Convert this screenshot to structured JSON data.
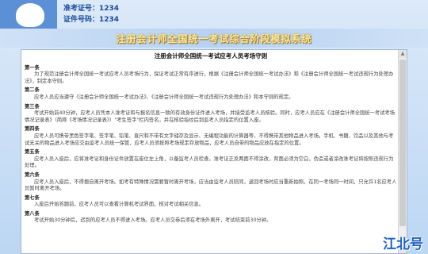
{
  "candidate": {
    "exam_no_label": "准考证号：",
    "exam_no": "1234",
    "id_no_label": "证件号码：",
    "id_no": "1234"
  },
  "banner": {
    "title": "注册会计师全国统一考试综合阶段模拟系统"
  },
  "rules": {
    "title": "注册会计师全国统一考试应考人员考场守则",
    "articles": [
      {
        "head": "第一条",
        "body": "为了规范注册会计师全国统一考试应考人员考场行为，保证考试正常有序进行，根据《注册会计师全国统一考试办法》和《注册会计师全国统一考试违规行为处理办法》，制定本守则。"
      },
      {
        "head": "第二条",
        "body": "应考人员应当遵守《注册会计师全国统一考试办法》、《注册会计师全国统一考试违规行为处理办法》和本守则的规定。"
      },
      {
        "head": "第三条",
        "body": "考试开始前40分钟，应考人员凭本人准考证和与报名信息一致的有效身份证件进入考场，并接受监考人员核验。同时，应考人员应在《注册会计师全国统一考试考场情况记录表》（简称《考场情况记录表》）\"考生签字\"栏内签名，并在核验指纹后到监考人员指定的位置入座。"
      },
      {
        "head": "第四条",
        "body": "应考人员可携带黑色签字笔、签字笔、铅笔、直尺和不带有文字储存及显示、无编程功能的计算器等，不得携带其他物品进入考场。手机、书籍、饮品以及其他与考试无关的物品进入考场应交由监考人员统一保管，应考人员须按照考场规定存放物品，应考人员自带的物品应放在指定的位置。"
      },
      {
        "head": "第五条",
        "body": "应考人员入座后，应将准考证和身份证件放置在座位左上角，以备监考人员检查。准考证正反两面不得涂改，背面必须为空白，伪造或者涂改准考证将按照违规行为处理。"
      },
      {
        "head": "第六条",
        "body": "应考人员入座后，不得擅自离开考场。如考有特殊情况需要暂时离开考场，应当由监考人员陪同，返回考场时应当重新拍照。在同一考场同一时间，只允许1名应考人员暂时离开考场。"
      },
      {
        "head": "第七条",
        "body": "入座后开始答题前，应考人员可以查看计算机考试界面，核对考试相关信息。"
      },
      {
        "head": "第八条",
        "body": "考试开始30分钟后，迟到的应考人员不得进入考场。应考人员交卷后须在考场外离开，考试结束前30分钟。"
      }
    ]
  },
  "watermark": "江北号",
  "icons": {
    "scroll_up": "scroll-up-icon",
    "scroll_down": "scroll-down-icon"
  },
  "colors": {
    "banner_title": "#f6e9a0",
    "info_text": "#1a4a9a",
    "watermark": "#1f62c8"
  }
}
